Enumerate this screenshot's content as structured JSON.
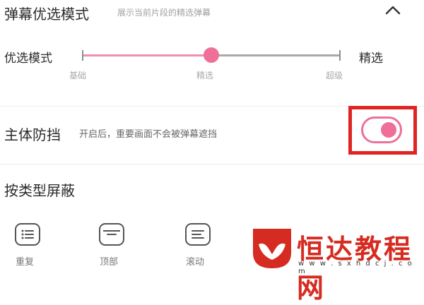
{
  "header": {
    "title": "弹幕优选模式",
    "subtitle": "展示当前片段的精选弹幕"
  },
  "slider": {
    "label": "优选模式",
    "right_label": "精选",
    "ticks": [
      "基础",
      "精选",
      "超级"
    ],
    "value": 0.5
  },
  "toggle": {
    "label": "主体防挡",
    "description": "开启后，重要画面不会被弹幕遮挡",
    "on": true
  },
  "filter": {
    "title": "按类型屏蔽",
    "items": [
      {
        "label": "重复",
        "icon": "list-icon"
      },
      {
        "label": "顶部",
        "icon": "top-bar-icon"
      },
      {
        "label": "滚动",
        "icon": "scroll-icon"
      }
    ]
  },
  "watermark": {
    "text": "恒达教程网",
    "url": "w w w . s x h d c j . c o m"
  },
  "colors": {
    "accent": "#ee6f98",
    "highlight": "#e02424",
    "watermark": "#d62b20"
  }
}
